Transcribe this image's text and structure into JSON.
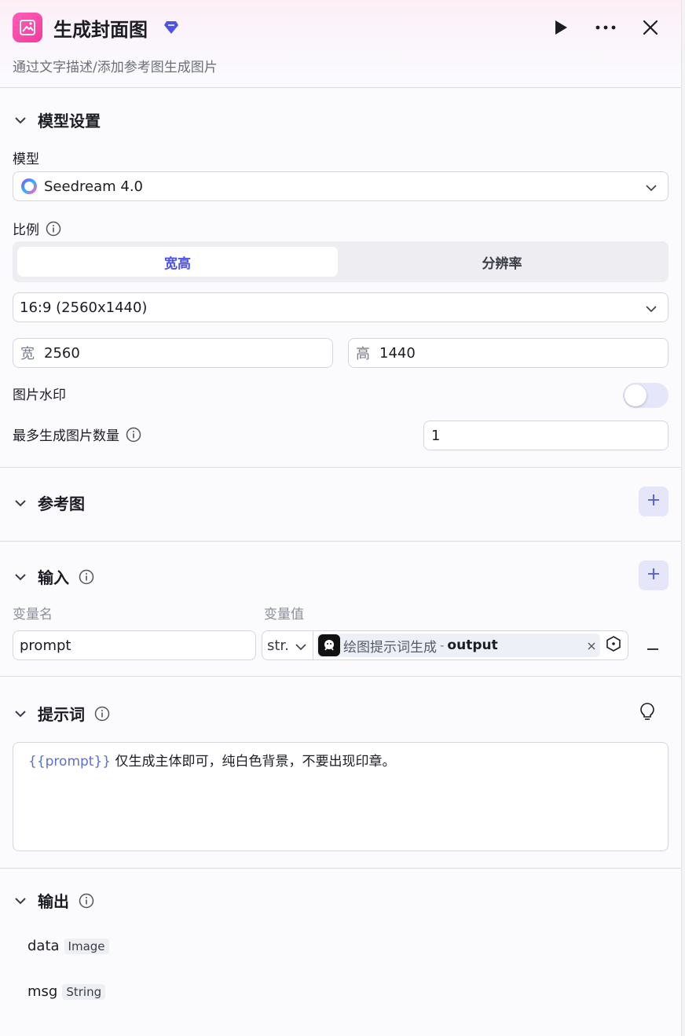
{
  "header": {
    "title": "生成封面图",
    "description": "通过文字描述/添加参考图生成图片",
    "icons": {
      "app": "image-generate-icon",
      "badge": "diamond-icon",
      "run": "play-icon",
      "more": "more-icon",
      "close": "close-icon"
    }
  },
  "model_settings": {
    "section_title": "模型设置",
    "model_label": "模型",
    "model_value": "Seedream 4.0",
    "ratio_label": "比例",
    "ratio_tabs": [
      "宽高",
      "分辨率"
    ],
    "ratio_active_tab": "宽高",
    "ratio_select": "16:9 (2560x1440)",
    "width_label": "宽",
    "width_value": "2560",
    "height_label": "高",
    "height_value": "1440",
    "watermark_label": "图片水印",
    "watermark_on": false,
    "max_images_label": "最多生成图片数量",
    "max_images_value": "1"
  },
  "reference": {
    "section_title": "参考图"
  },
  "inputs": {
    "section_title": "输入",
    "col_name": "变量名",
    "col_value": "变量值",
    "rows": [
      {
        "name": "prompt",
        "type": "str.",
        "ref_source": "绘图提示词生成",
        "ref_sep": "-",
        "ref_field": "output"
      }
    ]
  },
  "prompt": {
    "section_title": "提示词",
    "variable": "{{prompt}}",
    "text": " 仅生成主体即可，纯白色背景，不要出现印章。"
  },
  "output": {
    "section_title": "输出",
    "fields": [
      {
        "name": "data",
        "type": "Image"
      },
      {
        "name": "msg",
        "type": "String"
      }
    ]
  },
  "colors": {
    "accent": "#4d53e8",
    "brand_pink": "#f23a9c"
  }
}
